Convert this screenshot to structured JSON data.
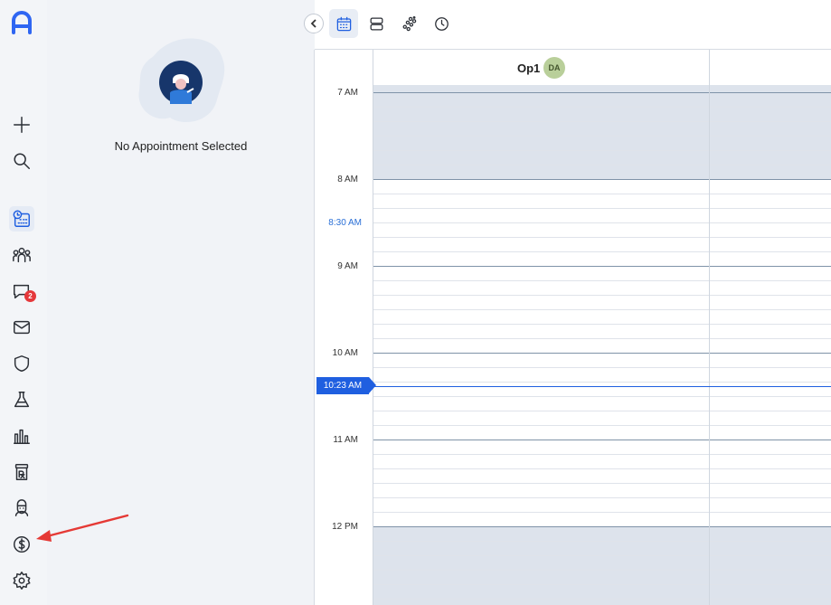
{
  "sidebar": {
    "logo": "app-logo",
    "items": [
      {
        "name": "add-icon"
      },
      {
        "name": "search-icon"
      },
      {
        "name": "schedule-icon",
        "active": true
      },
      {
        "name": "patients-icon"
      },
      {
        "name": "messages-icon",
        "badge": "2"
      },
      {
        "name": "mail-icon"
      },
      {
        "name": "insurance-shield-icon"
      },
      {
        "name": "lab-flask-icon"
      },
      {
        "name": "reports-chart-icon"
      },
      {
        "name": "prescription-icon"
      },
      {
        "name": "provider-icon"
      },
      {
        "name": "billing-dollar-icon"
      },
      {
        "name": "settings-gear-icon"
      }
    ]
  },
  "panel": {
    "empty_message": "No Appointment Selected"
  },
  "toolbar": {
    "buttons": [
      "calendar-view-icon",
      "list-view-icon",
      "group-view-icon",
      "history-clock-icon"
    ],
    "active": "calendar-view-icon"
  },
  "calendar": {
    "operatory": "Op1",
    "provider_initials": "DA",
    "time_labels": [
      "7 AM",
      "8 AM",
      "8:30 AM",
      "9 AM",
      "10 AM",
      "11 AM",
      "12 PM"
    ],
    "current_time": "10:23 AM"
  },
  "colors": {
    "accent": "#1f5fe0",
    "blocked": "#dde3ec",
    "badge": "#e5383b",
    "annotation_arrow": "#e53935"
  }
}
